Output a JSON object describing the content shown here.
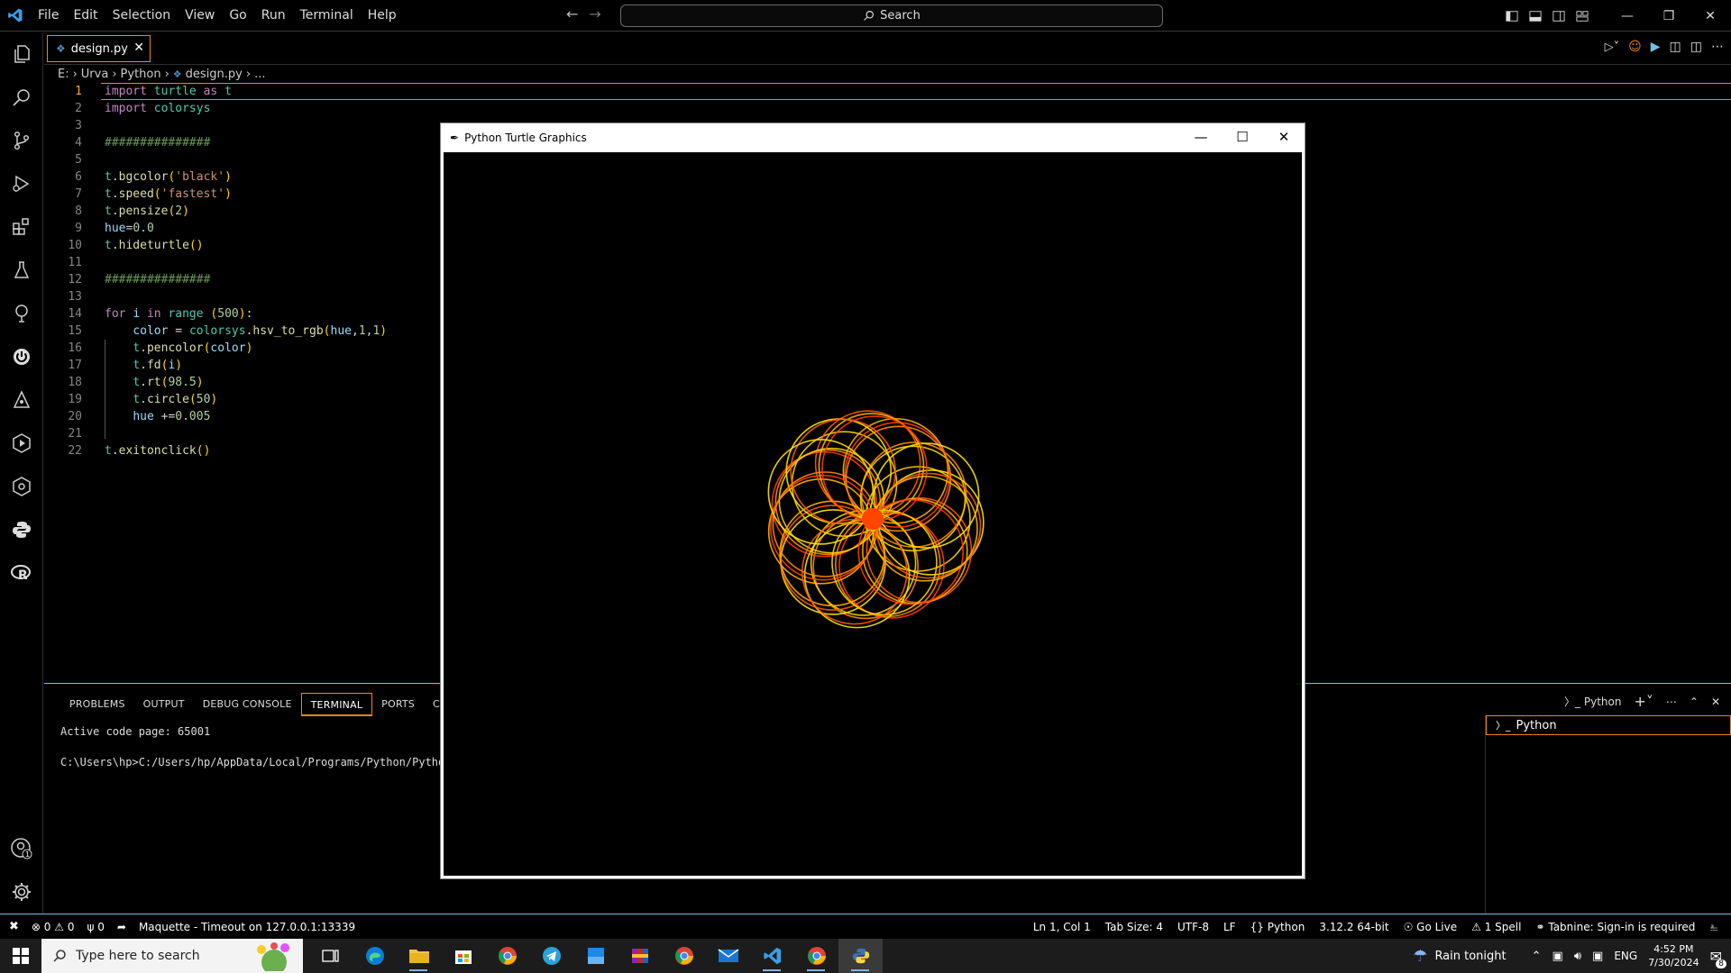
{
  "menu": [
    "File",
    "Edit",
    "Selection",
    "View",
    "Go",
    "Run",
    "Terminal",
    "Help"
  ],
  "search": {
    "label": "Search"
  },
  "tab": {
    "filename": "design.py"
  },
  "breadcrumb": [
    "E:",
    "Urva",
    "Python",
    "design.py",
    "..."
  ],
  "code_lines": [
    {
      "n": "1",
      "html": "<span class='k'>import</span> <span class='m'>turtle</span> <span class='k'>as</span> <span class='m'>t</span>"
    },
    {
      "n": "2",
      "html": "<span class='k'>import</span> <span class='m'>colorsys</span>"
    },
    {
      "n": "3",
      "html": ""
    },
    {
      "n": "4",
      "html": "<span class='c'>###############</span>"
    },
    {
      "n": "5",
      "html": ""
    },
    {
      "n": "6",
      "html": "<span class='m'>t</span>.<span class='f'>bgcolor</span><span class='pl'>(</span><span class='s'>'black'</span><span class='pl'>)</span>"
    },
    {
      "n": "7",
      "html": "<span class='m'>t</span>.<span class='f'>speed</span><span class='pl'>(</span><span class='s'>'fastest'</span><span class='pl'>)</span>"
    },
    {
      "n": "8",
      "html": "<span class='m'>t</span>.<span class='f'>pensize</span><span class='pl'>(</span><span class='n'>2</span><span class='pl'>)</span>"
    },
    {
      "n": "9",
      "html": "<span class='v'>hue</span>=<span class='n'>0.0</span>"
    },
    {
      "n": "10",
      "html": "<span class='m'>t</span>.<span class='f'>hideturtle</span><span class='pl'>()</span>"
    },
    {
      "n": "11",
      "html": ""
    },
    {
      "n": "12",
      "html": "<span class='c'>###############</span>"
    },
    {
      "n": "13",
      "html": ""
    },
    {
      "n": "14",
      "html": "<span class='k'>for</span> <span class='v'>i</span> <span class='k'>in</span> <span class='m'>range</span> <span class='pl'>(</span><span class='n'>500</span><span class='pl'>)</span>:"
    },
    {
      "n": "15",
      "html": "    <span class='v'>color</span> = <span class='m'>colorsys</span>.<span class='f'>hsv_to_rgb</span><span class='pl'>(</span><span class='v'>hue</span>,<span class='n'>1</span>,<span class='n'>1</span><span class='pl'>)</span>"
    },
    {
      "n": "16",
      "html": "    <span class='m'>t</span>.<span class='f'>pencolor</span><span class='pl'>(</span><span class='v'>color</span><span class='pl'>)</span>"
    },
    {
      "n": "17",
      "html": "    <span class='m'>t</span>.<span class='f'>fd</span><span class='pl'>(</span><span class='v'>i</span><span class='pl'>)</span>"
    },
    {
      "n": "18",
      "html": "    <span class='m'>t</span>.<span class='f'>rt</span><span class='pl'>(</span><span class='n'>98.5</span><span class='pl'>)</span>"
    },
    {
      "n": "19",
      "html": "    <span class='m'>t</span>.<span class='f'>circle</span><span class='pl'>(</span><span class='n'>50</span><span class='pl'>)</span>"
    },
    {
      "n": "20",
      "html": "    <span class='v'>hue</span> +=<span class='n'>0.005</span>"
    },
    {
      "n": "21",
      "html": ""
    },
    {
      "n": "22",
      "html": "<span class='m'>t</span>.<span class='f'>exitonclick</span><span class='pl'>()</span>"
    }
  ],
  "panel": {
    "tabs": [
      "PROBLEMS",
      "OUTPUT",
      "DEBUG CONSOLE",
      "TERMINAL",
      "PORTS",
      "COMM"
    ],
    "terminal_lines": [
      "Active code page: 65001",
      "C:\\Users\\hp>C:/Users/hp/AppData/Local/Programs/Python/Python"
    ],
    "shell_label": "Python",
    "terminal_item": "Python"
  },
  "turtle_window": {
    "title": "Python Turtle Graphics"
  },
  "statusbar": {
    "errors": "0",
    "warnings": "0",
    "ports": "0",
    "maquette": "Maquette - Timeout on 127.0.0.1:13339",
    "position": "Ln 1, Col 1",
    "tabsize": "Tab Size: 4",
    "encoding": "UTF-8",
    "eol": "LF",
    "language": "Python",
    "interpreter": "3.12.2 64-bit",
    "golive": "Go Live",
    "spell": "1 Spell",
    "tabnine": "Tabnine: Sign-in is required"
  },
  "taskbar": {
    "search_placeholder": "Type here to search",
    "weather": "Rain tonight",
    "lang": "ENG",
    "time": "4:52 PM",
    "date": "7/30/2024",
    "notif_count": "8"
  },
  "colors": {
    "accent": "#f38518",
    "border_hc": "#6fc3df"
  }
}
